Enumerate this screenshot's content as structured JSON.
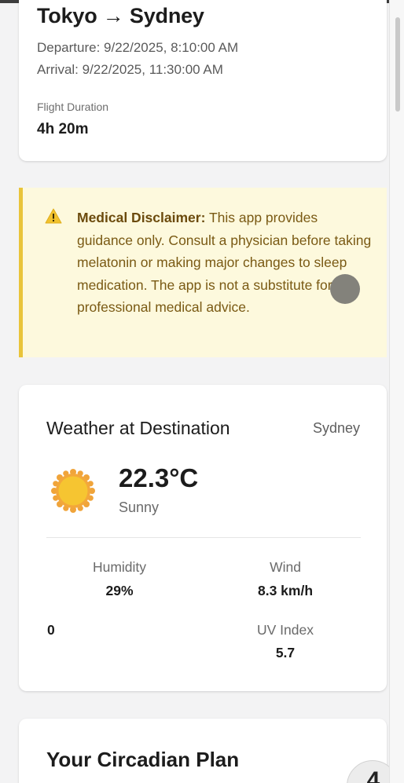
{
  "flight": {
    "route": "Tokyo → Sydney",
    "departure": "Departure: 9/22/2025, 8:10:00 AM",
    "arrival": "Arrival: 9/22/2025, 11:30:00 AM",
    "duration_label": "Flight Duration",
    "duration_value": "4h 20m"
  },
  "disclaimer": {
    "icon": "warning-icon",
    "heading": "Medical Disclaimer:",
    "body": " This app provides guidance only. Consult a physician before taking melatonin or making major changes to sleep medication. The app is not a substitute for professional medical advice.",
    "accent_color": "#e9c43a",
    "background_color": "#fdf9dd"
  },
  "weather": {
    "title": "Weather at Destination",
    "city": "Sydney",
    "icon": "sun-icon",
    "temperature": "22.3°C",
    "condition": "Sunny",
    "humidity_label": "Humidity",
    "humidity_value": "29%",
    "wind_label": "Wind",
    "wind_value": "8.3 km/h",
    "extra_value": "0",
    "uv_label": "UV Index",
    "uv_value": "5.7"
  },
  "plan": {
    "title": "Your Circadian Plan"
  },
  "fab": {
    "glyph": "4"
  }
}
